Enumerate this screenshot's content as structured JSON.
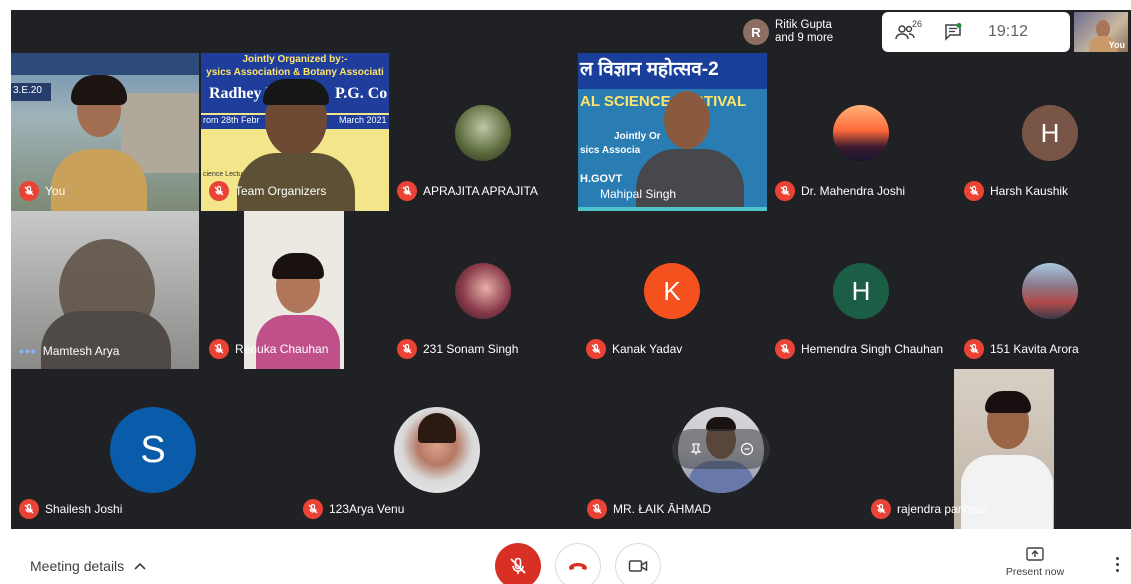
{
  "notification": {
    "avatar_letter": "R",
    "line1": "Ritik Gupta",
    "line2": "and 9 more"
  },
  "top": {
    "participants_count": "26",
    "time": "19:12",
    "self_label": "You"
  },
  "tiles": [
    {
      "name": "You",
      "mic": "off",
      "type": "video"
    },
    {
      "name": "Team Organizers",
      "mic": "off",
      "type": "video",
      "banner": {
        "line1": "Jointly Organized by:-",
        "line2": "ysics Association & Botany Associati",
        "line3": "Radhey H",
        "line4": "P.G. Co",
        "line5": "rom 28th Febr",
        "line6": "March 2021",
        "line7": "cience Lecture"
      }
    },
    {
      "name": "APRAJITA APRAJITA",
      "mic": "off",
      "type": "photo"
    },
    {
      "name": "Mahipal Singh",
      "mic": "off",
      "type": "video",
      "banner": {
        "line1": "ल विज्ञान महोत्सव-2",
        "line2": "AL SCIENCE FESTIVAL",
        "line3": "Jointly Or",
        "line4": "sics Associa",
        "line5": "H.GOVT"
      }
    },
    {
      "name": "Dr. Mahendra Joshi",
      "mic": "off",
      "type": "photo"
    },
    {
      "name": "Harsh Kaushik",
      "mic": "off",
      "type": "letter",
      "letter": "H"
    },
    {
      "name": "Mamtesh Arya",
      "mic": "speaking",
      "type": "video"
    },
    {
      "name": "Renuka Chauhan",
      "mic": "off",
      "type": "video"
    },
    {
      "name": "231 Sonam Singh",
      "mic": "off",
      "type": "photo"
    },
    {
      "name": "Kanak Yadav",
      "mic": "off",
      "type": "letter",
      "letter": "K"
    },
    {
      "name": "Hemendra Singh Chauhan",
      "mic": "off",
      "type": "letter",
      "letter": "H"
    },
    {
      "name": "151 Kavita Arora",
      "mic": "off",
      "type": "photo"
    },
    {
      "name": "Shailesh Joshi",
      "mic": "off",
      "type": "letter",
      "letter": "S"
    },
    {
      "name": "123Arya Venu",
      "mic": "off",
      "type": "photo"
    },
    {
      "name": "MR. ŁAIK ĀHMAD",
      "mic": "off",
      "type": "photo"
    },
    {
      "name": "rajendra parihaar",
      "mic": "off",
      "type": "video"
    }
  ],
  "colors": {
    "harsh": "#795548",
    "kanak": "#f4511e",
    "hemendra": "#1b5e45",
    "shailesh": "#0b5bab",
    "mic_off": "#ea4335",
    "stage": "#202124"
  },
  "bottom": {
    "meeting_details": "Meeting details",
    "present_now": "Present now"
  }
}
